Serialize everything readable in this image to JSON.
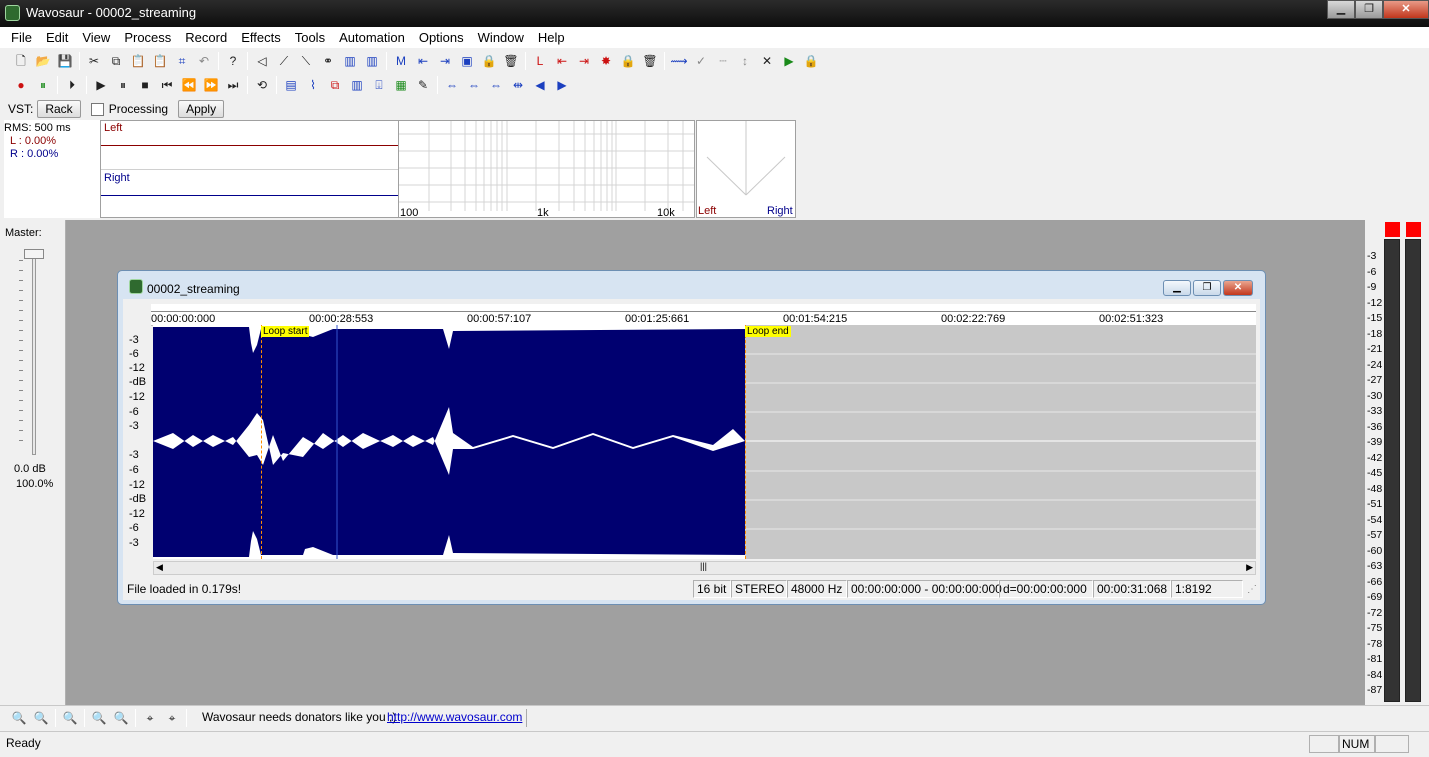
{
  "window": {
    "title": "Wavosaur - 00002_streaming"
  },
  "menu": [
    "File",
    "Edit",
    "View",
    "Process",
    "Record",
    "Effects",
    "Tools",
    "Automation",
    "Options",
    "Window",
    "Help"
  ],
  "vst": {
    "label": "VST:",
    "rack": "Rack",
    "processing": "Processing",
    "apply": "Apply"
  },
  "rms": {
    "header": "RMS: 500 ms",
    "left": "L : 0.00%",
    "right": "R : 0.00%"
  },
  "levels": {
    "left": "Left",
    "right": "Right"
  },
  "freq": {
    "labels": [
      "100",
      "1k",
      "10k"
    ]
  },
  "stereo": {
    "left": "Left",
    "right": "Right"
  },
  "master": {
    "label": "Master:",
    "db": "0.0 dB",
    "percent": "100.0%"
  },
  "doc": {
    "title": "00002_streaming",
    "timeline": [
      "00:00:00:000",
      "00:00:28:553",
      "00:00:57:107",
      "00:01:25:661",
      "00:01:54:215",
      "00:02:22:769",
      "00:02:51:323"
    ],
    "ruler_top": [
      "-3",
      "-6",
      "-12",
      "-dB",
      "-12",
      "-6",
      "-3"
    ],
    "ruler_bottom": [
      "-3",
      "-6",
      "-12",
      "-dB",
      "-12",
      "-6",
      "-3"
    ],
    "loop_start": "Loop start",
    "loop_end": "Loop end",
    "status": {
      "message": "File loaded in 0.179s!",
      "bits": "16 bit",
      "channels": "STEREO",
      "rate": "48000 Hz",
      "selection": "00:00:00:000 - 00:00:00:000",
      "duration": "d=00:00:00:000",
      "position": "00:00:31:068",
      "zoom": "1:8192"
    }
  },
  "meter": {
    "ticks": [
      "-3",
      "-6",
      "-9",
      "-12",
      "-15",
      "-18",
      "-21",
      "-24",
      "-27",
      "-30",
      "-33",
      "-36",
      "-39",
      "-42",
      "-45",
      "-48",
      "-51",
      "-54",
      "-57",
      "-60",
      "-63",
      "-66",
      "-69",
      "-72",
      "-75",
      "-78",
      "-81",
      "-84",
      "-87"
    ]
  },
  "bottom": {
    "message": "Wavosaur needs donators like you ;)",
    "link": "http://www.wavosaur.com"
  },
  "statusbar": {
    "text": "Ready",
    "num": "NUM"
  },
  "colors": {
    "wave_bg": "#000070",
    "wave_fg": "#ffffff",
    "loop_marker": "#ffff00",
    "meter_clip": "#ff0000"
  }
}
